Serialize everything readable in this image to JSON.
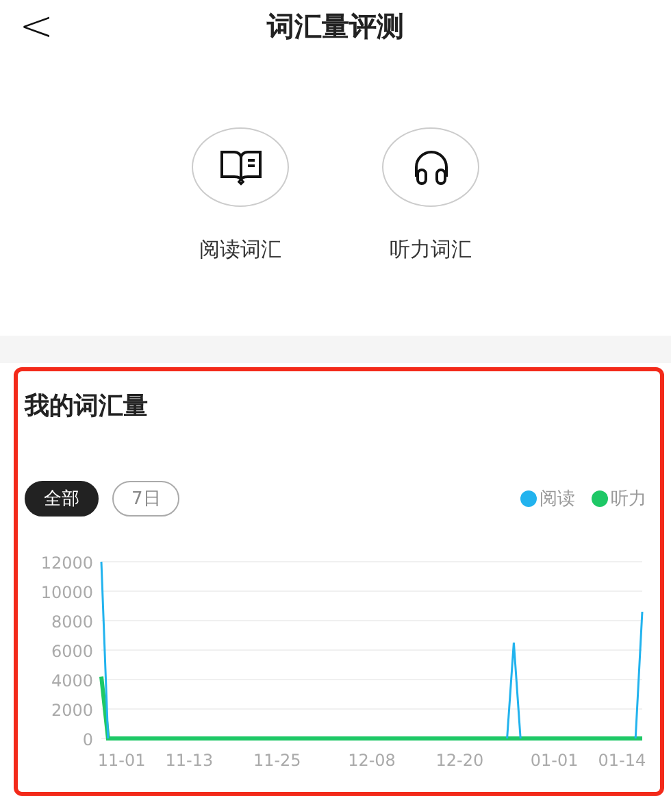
{
  "header": {
    "back": "<",
    "title": "词汇量评测"
  },
  "modes": [
    {
      "label": "阅读词汇",
      "kind": "reading"
    },
    {
      "label": "听力词汇",
      "kind": "listening"
    }
  ],
  "card": {
    "title": "我的词汇量",
    "highlighted": true,
    "filters": [
      {
        "label": "全部",
        "selected": true
      },
      {
        "label": "7日",
        "selected": false
      }
    ],
    "chart_data": {
      "type": "line",
      "grid": true,
      "ylim": [
        0,
        12000
      ],
      "categories": [
        null,
        null,
        null,
        "11-01",
        null,
        null,
        null,
        null,
        null,
        null,
        null,
        null,
        null,
        "11-13",
        null,
        null,
        null,
        null,
        null,
        null,
        null,
        null,
        null,
        null,
        null,
        null,
        "11-25",
        null,
        null,
        null,
        null,
        null,
        null,
        null,
        null,
        null,
        null,
        null,
        null,
        null,
        "12-08",
        null,
        null,
        null,
        null,
        null,
        null,
        null,
        null,
        null,
        null,
        null,
        null,
        "12-20",
        null,
        null,
        null,
        null,
        null,
        null,
        null,
        null,
        null,
        null,
        null,
        null,
        null,
        "01-01",
        null,
        null,
        null,
        null,
        null,
        null,
        null,
        null,
        null,
        "01-14",
        null,
        null,
        null
      ],
      "yticks": [
        0,
        2000,
        4000,
        6000,
        8000,
        10000,
        12000
      ],
      "series": [
        {
          "name": "阅读",
          "color": "#22b3ee",
          "values": [
            12000,
            0,
            null,
            null,
            null,
            null,
            null,
            null,
            null,
            null,
            null,
            null,
            null,
            null,
            null,
            null,
            null,
            null,
            null,
            null,
            null,
            null,
            null,
            null,
            null,
            null,
            null,
            null,
            null,
            null,
            null,
            null,
            null,
            null,
            null,
            null,
            null,
            null,
            null,
            null,
            null,
            null,
            null,
            null,
            null,
            null,
            null,
            null,
            null,
            null,
            null,
            null,
            null,
            null,
            null,
            null,
            null,
            null,
            null,
            null,
            0,
            6500,
            0,
            null,
            null,
            null,
            null,
            null,
            null,
            null,
            null,
            null,
            null,
            null,
            null,
            null,
            null,
            null,
            null,
            0,
            8600
          ]
        },
        {
          "name": "听力",
          "color": "#1ec866",
          "values": [
            4200,
            0,
            0,
            0,
            0,
            0,
            0,
            0,
            0,
            0,
            0,
            0,
            0,
            0,
            0,
            0,
            0,
            0,
            0,
            0,
            0,
            0,
            0,
            0,
            0,
            0,
            0,
            0,
            0,
            0,
            0,
            0,
            0,
            0,
            0,
            0,
            0,
            0,
            0,
            0,
            0,
            0,
            0,
            0,
            0,
            0,
            0,
            0,
            0,
            0,
            0,
            0,
            0,
            0,
            0,
            0,
            0,
            0,
            0,
            0,
            0,
            0,
            0,
            0,
            0,
            0,
            0,
            0,
            0,
            0,
            0,
            0,
            0,
            0,
            0,
            0,
            0,
            0,
            0,
            0,
            0
          ]
        }
      ]
    }
  }
}
